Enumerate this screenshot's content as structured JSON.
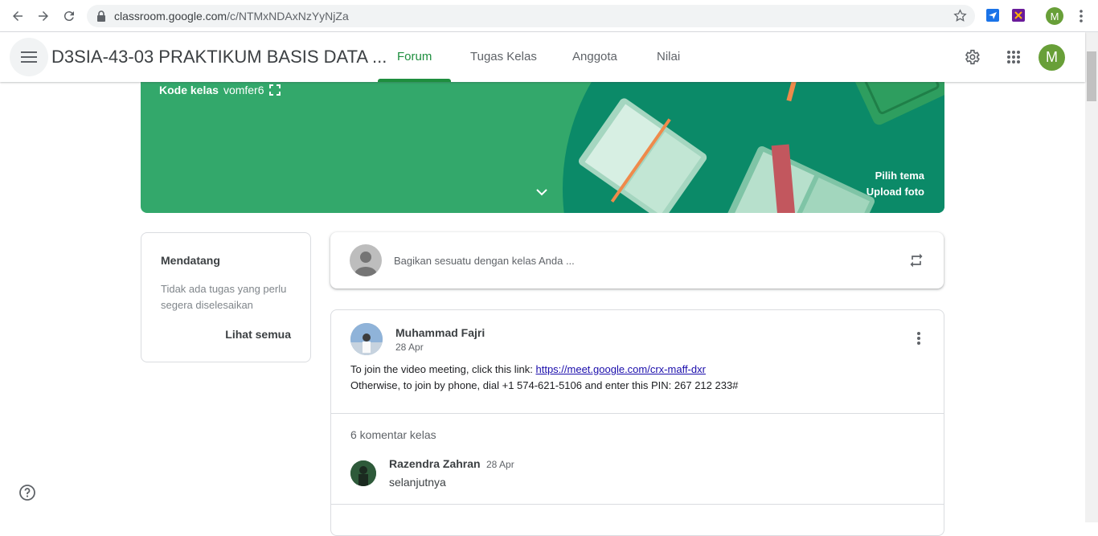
{
  "browser": {
    "url_host": "classroom.google.com",
    "url_path": "/c/NTMxNDAxNzYyNjZa",
    "profile_initial": "M"
  },
  "header": {
    "course_title": "D3SIA-43-03 PRAKTIKUM BASIS DATA ...",
    "tabs": [
      {
        "label": "Forum",
        "active": true
      },
      {
        "label": "Tugas Kelas",
        "active": false
      },
      {
        "label": "Anggota",
        "active": false
      },
      {
        "label": "Nilai",
        "active": false
      }
    ],
    "avatar_initial": "M",
    "accent_color": "#1e8e3e"
  },
  "banner": {
    "class_code_label": "Kode kelas",
    "class_code": "vomfer6",
    "select_theme": "Pilih tema",
    "upload_photo": "Upload foto",
    "color": "#33a86b"
  },
  "upcoming": {
    "title": "Mendatang",
    "description": "Tidak ada tugas yang perlu segera diselesaikan",
    "view_all": "Lihat semua"
  },
  "share": {
    "placeholder": "Bagikan sesuatu dengan kelas Anda ..."
  },
  "post": {
    "author": "Muhammad Fajri",
    "date": "28 Apr",
    "line1_prefix": "To join the video meeting, click this link: ",
    "line1_link": "https://meet.google.com/crx-maff-dxr",
    "line2": "Otherwise, to join by phone, dial +1 574-621-5106 and enter this PIN: 267 212 233#",
    "comments_count": "6 komentar kelas",
    "comment": {
      "author": "Razendra Zahran",
      "date": "28 Apr",
      "text": "selanjutnya"
    }
  }
}
